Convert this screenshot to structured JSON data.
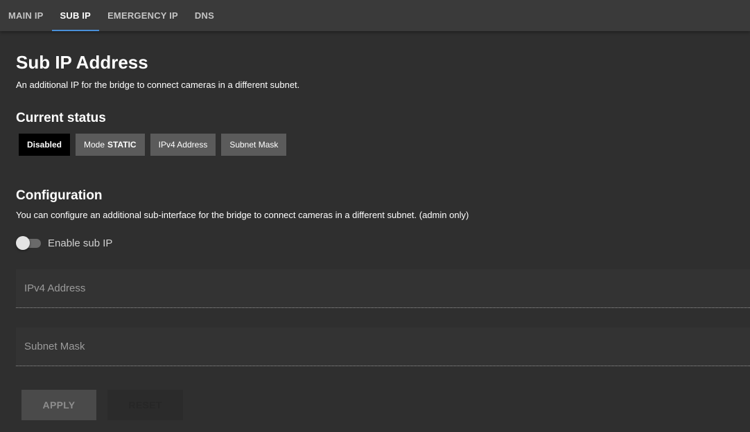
{
  "tabs": [
    {
      "label": "MAIN IP",
      "active": false
    },
    {
      "label": "SUB IP",
      "active": true
    },
    {
      "label": "EMERGENCY IP",
      "active": false
    },
    {
      "label": "DNS",
      "active": false
    }
  ],
  "header": {
    "title": "Sub IP Address",
    "subtitle": "An additional IP for the bridge to connect cameras in a different subnet."
  },
  "status": {
    "heading": "Current status",
    "state": "Disabled",
    "mode_prefix": "Mode",
    "mode_value": "STATIC",
    "ipv4": "IPv4 Address",
    "subnet": "Subnet Mask"
  },
  "config": {
    "heading": "Configuration",
    "description": "You can configure an additional sub-interface for the bridge to connect cameras in a different subnet. (admin only)",
    "toggle_label": "Enable sub IP",
    "toggle_on": false,
    "ipv4_placeholder": "IPv4 Address",
    "subnet_placeholder": "Subnet Mask"
  },
  "actions": {
    "apply": "APPLY",
    "reset": "RESET"
  },
  "colors": {
    "background": "#2f2f2f",
    "tabbar": "#3a3a3a",
    "accent": "#4a90d9",
    "chip": "#5b5b5b",
    "chip_disabled": "#000000"
  }
}
